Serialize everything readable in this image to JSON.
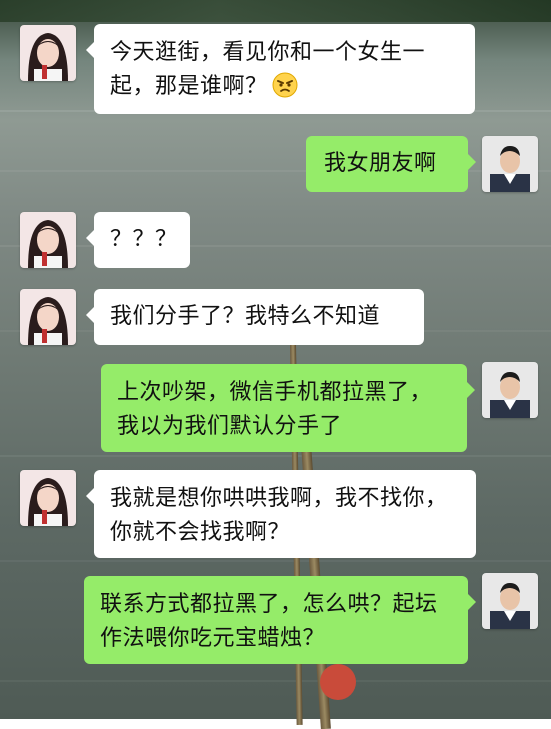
{
  "messages": [
    {
      "side": "left",
      "text": "今天逛街，看见你和一个女生一起，那是谁啊？",
      "emoji": "angry-face"
    },
    {
      "side": "right",
      "text": "我女朋友啊"
    },
    {
      "side": "left",
      "text": "？？？"
    },
    {
      "side": "left",
      "text": "我们分手了？我特么不知道"
    },
    {
      "side": "right",
      "text": "上次吵架，微信手机都拉黑了，我以为我们默认分手了"
    },
    {
      "side": "left",
      "text": "我就是想你哄哄我啊，我不找你，你就不会找我啊？"
    },
    {
      "side": "right",
      "text": "联系方式都拉黑了，怎么哄？起坛作法喂你吃元宝蜡烛？"
    }
  ],
  "colors": {
    "left_bubble": "#ffffff",
    "right_bubble": "#95ec69"
  }
}
